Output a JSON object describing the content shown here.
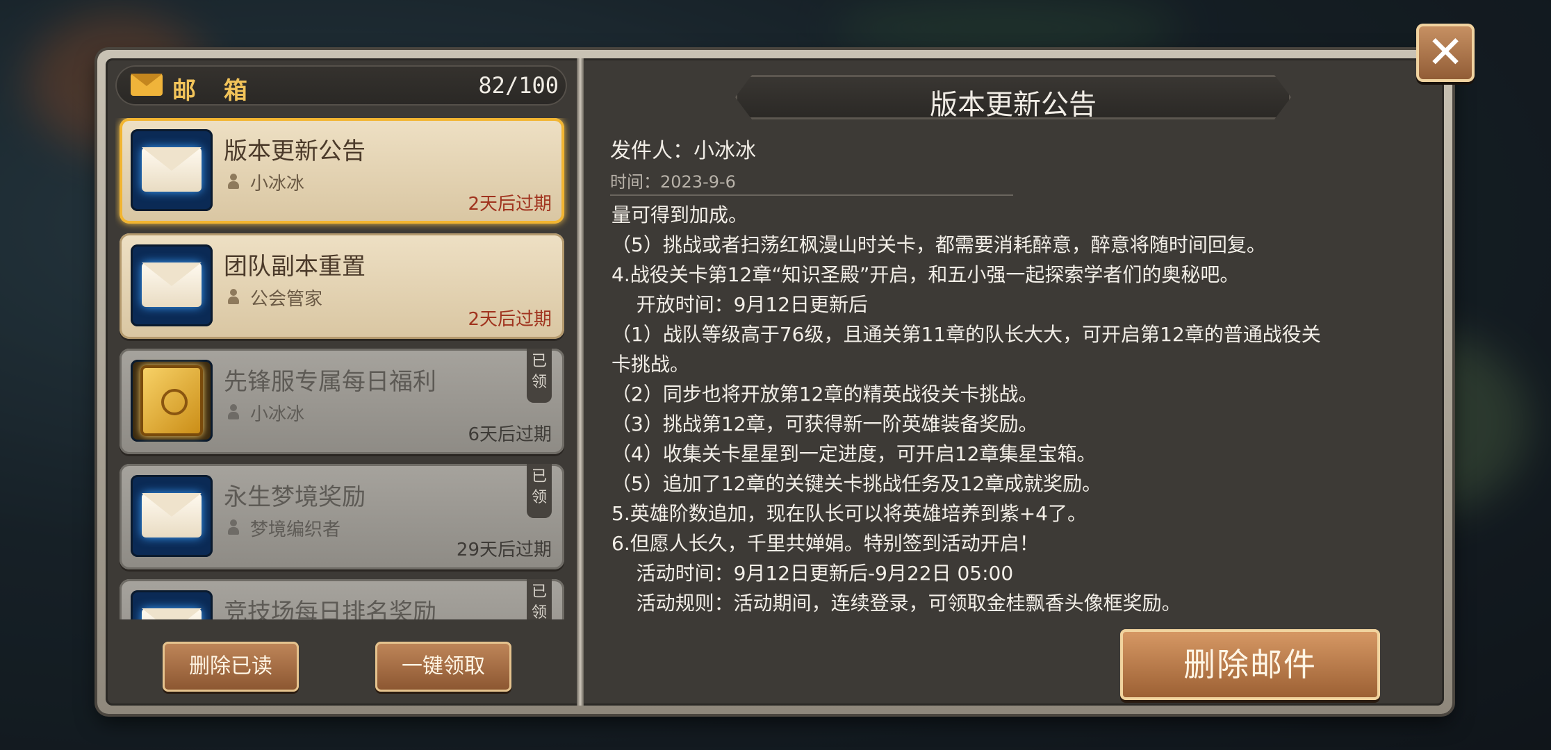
{
  "mailbox": {
    "title": "邮 箱",
    "count": "82/100",
    "items": [
      {
        "title": "版本更新公告",
        "sender": "小冰冰",
        "expire": "2天后过期",
        "claimed": ""
      },
      {
        "title": "团队副本重置",
        "sender": "公会管家",
        "expire": "2天后过期",
        "claimed": ""
      },
      {
        "title": "先锋服专属每日福利",
        "sender": "小冰冰",
        "expire": "6天后过期",
        "claimed": "已领"
      },
      {
        "title": "永生梦境奖励",
        "sender": "梦境编织者",
        "expire": "29天后过期",
        "claimed": "已领"
      },
      {
        "title": "竞技场每日排名奖励",
        "sender": "",
        "expire": "",
        "claimed": "已领"
      }
    ],
    "buttons": {
      "delete_read": "删除已读",
      "claim_all": "一键领取"
    }
  },
  "detail": {
    "title": "版本更新公告",
    "sender": "发件人：小冰冰",
    "time": "时间：2023-9-6",
    "lines": [
      "量可得到加成。",
      "（5）挑战或者扫荡红枫漫山时关卡，都需要消耗醉意，醉意将随时间回复。",
      "4.战役关卡第12章“知识圣殿”开启，和五小强一起探索学者们的奥秘吧。",
      "    开放时间：9月12日更新后",
      "（1）战队等级高于76级，且通关第11章的队长大大，可开启第12章的普通战役关",
      "卡挑战。",
      "（2）同步也将开放第12章的精英战役关卡挑战。",
      "（3）挑战第12章，可获得新一阶英雄装备奖励。",
      "（4）收集关卡星星到一定进度，可开启12章集星宝箱。",
      "（5）追加了12章的关键关卡挑战任务及12章成就奖励。",
      "5.英雄阶数追加，现在队长可以将英雄培养到紫+4了。",
      "6.但愿人长久，千里共婵娟。特别签到活动开启！",
      "    活动时间：9月12日更新后-9月22日 05:00",
      "    活动规则：活动期间，连续登录，可领取金桂飘香头像框奖励。"
    ],
    "delete_button": "删除邮件"
  },
  "close_label": "✕"
}
